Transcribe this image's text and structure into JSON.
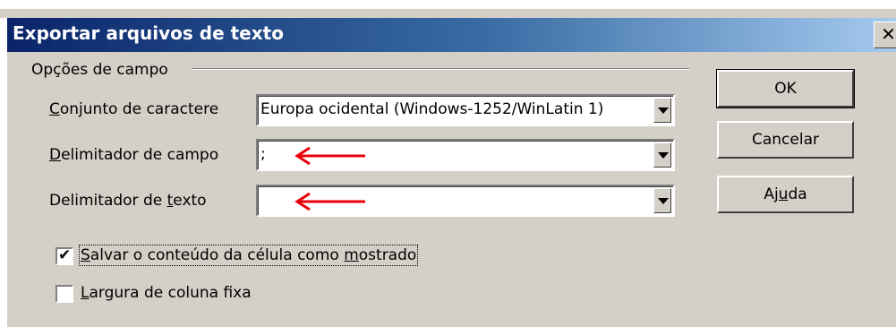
{
  "dialog": {
    "title": "Exportar arquivos de texto",
    "close_glyph": "✕"
  },
  "field_options": {
    "group_label": "Opções de campo",
    "charset": {
      "label_prefix": "",
      "label_ul": "C",
      "label_rest": "onjunto de caractere",
      "value": "Europa ocidental (Windows-1252/WinLatin 1)"
    },
    "field_delimiter": {
      "label_ul": "D",
      "label_rest": "elimitador de campo",
      "value": ";"
    },
    "text_delimiter": {
      "label_prefix": "Delimitador de ",
      "label_ul": "t",
      "label_rest": "exto",
      "value": ""
    },
    "save_as_shown": {
      "checked": true,
      "label_ul": "S",
      "label_mid": "alvar o conteúdo da célula como ",
      "label_ul2": "m",
      "label_rest": "ostrado"
    },
    "fixed_width": {
      "checked": false,
      "label_ul": "L",
      "label_rest": "argura de coluna fixa"
    }
  },
  "buttons": {
    "ok": "OK",
    "cancel": "Cancelar",
    "help_prefix": "Aj",
    "help_ul": "u",
    "help_rest": "da"
  },
  "icons": {
    "check": "✔",
    "annotation_color": "#e8000b"
  }
}
